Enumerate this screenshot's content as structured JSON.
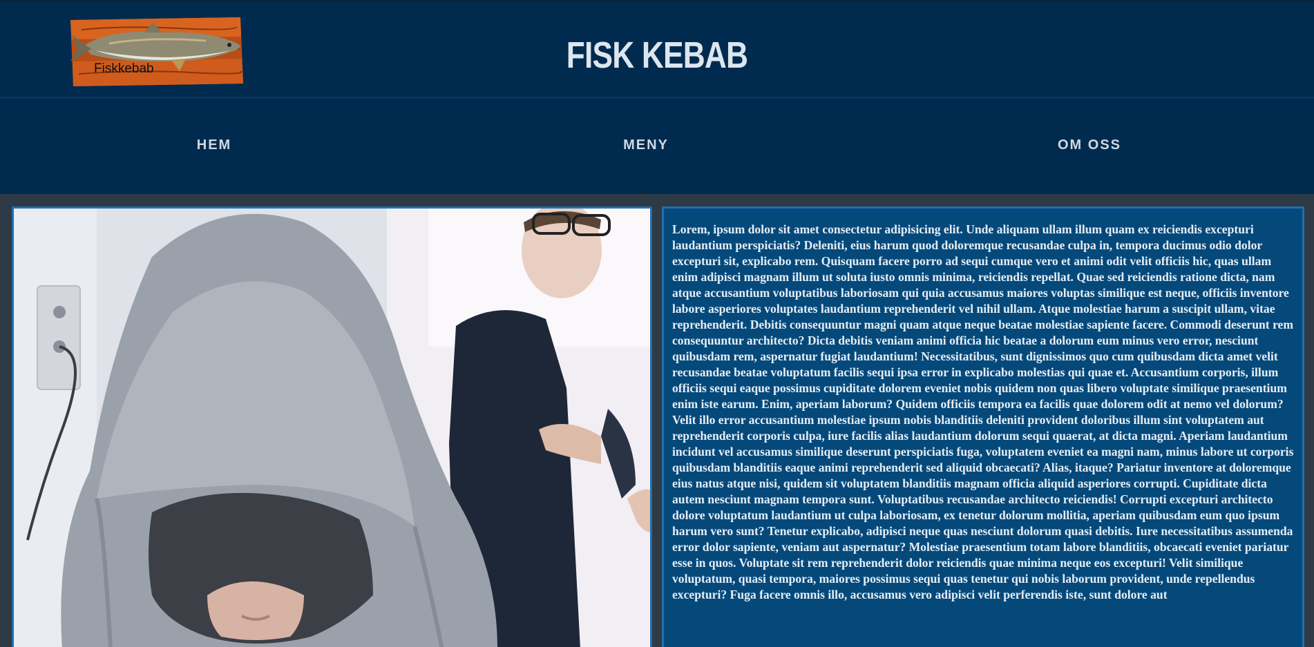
{
  "header": {
    "logo_label": "Fiskkebab",
    "title": "FISK KEBAB"
  },
  "nav": {
    "items": [
      {
        "label": "HEM"
      },
      {
        "label": "MENY"
      },
      {
        "label": "OM OSS"
      }
    ]
  },
  "content": {
    "body_text": "Lorem, ipsum dolor sit amet consectetur adipisicing elit. Unde aliquam ullam illum quam ex reiciendis excepturi laudantium perspiciatis? Deleniti, eius harum quod doloremque recusandae culpa in, tempora ducimus odio dolor excepturi sit, explicabo rem. Quisquam facere porro ad sequi cumque vero et animi odit velit officiis hic, quas ullam enim adipisci magnam illum ut soluta iusto omnis minima, reiciendis repellat. Quae sed reiciendis ratione dicta, nam atque accusantium voluptatibus laboriosam qui quia accusamus maiores voluptas similique est neque, officiis inventore labore asperiores voluptates laudantium reprehenderit vel nihil ullam. Atque molestiae harum a suscipit ullam, vitae reprehenderit. Debitis consequuntur magni quam atque neque beatae molestiae sapiente facere. Commodi deserunt rem consequuntur architecto? Dicta debitis veniam animi officia hic beatae a dolorum eum minus vero error, nesciunt quibusdam rem, aspernatur fugiat laudantium! Necessitatibus, sunt dignissimos quo cum quibusdam dicta amet velit recusandae beatae voluptatum facilis sequi ipsa error in explicabo molestias qui quae et. Accusantium corporis, illum officiis sequi eaque possimus cupiditate dolorem eveniet nobis quidem non quas libero voluptate similique praesentium enim iste earum. Enim, aperiam laborum? Quidem officiis tempora ea facilis quae dolorem odit at nemo vel dolorum? Velit illo error accusantium molestiae ipsum nobis blanditiis deleniti provident doloribus illum sint voluptatem aut reprehenderit corporis culpa, iure facilis alias laudantium dolorum sequi quaerat, at dicta magni. Aperiam laudantium incidunt vel accusamus similique deserunt perspiciatis fuga, voluptatem eveniet ea magni nam, minus labore ut corporis quibusdam blanditiis eaque animi reprehenderit sed aliquid obcaecati? Alias, itaque? Pariatur inventore at doloremque eius natus atque nisi, quidem sit voluptatem blanditiis magnam officia aliquid asperiores corrupti. Cupiditate dicta autem nesciunt magnam tempora sunt. Voluptatibus recusandae architecto reiciendis! Corrupti excepturi architecto dolore voluptatum laudantium ut culpa laboriosam, ex tenetur dolorum mollitia, aperiam quibusdam eum quo ipsum harum vero sunt? Tenetur explicabo, adipisci neque quas nesciunt dolorum quasi debitis. Iure necessitatibus assumenda error dolor sapiente, veniam aut aspernatur? Molestiae praesentium totam labore blanditiis, obcaecati eveniet pariatur esse in quos. Voluptate sit rem reprehenderit dolor reiciendis quae minima neque eos excepturi! Velit similique voluptatum, quasi tempora, maiores possimus sequi quas tenetur qui nobis laborum provident, unde repellendus excepturi? Fuga facere omnis illo, accusamus vero adipisci velit perferendis iste, sunt dolore aut"
  },
  "colors": {
    "header_bg": "#002b4f",
    "page_bg": "#2e3a45",
    "panel_bg": "#05497b",
    "panel_border": "#1f6fb0",
    "nav_text": "#cfd9e3"
  }
}
